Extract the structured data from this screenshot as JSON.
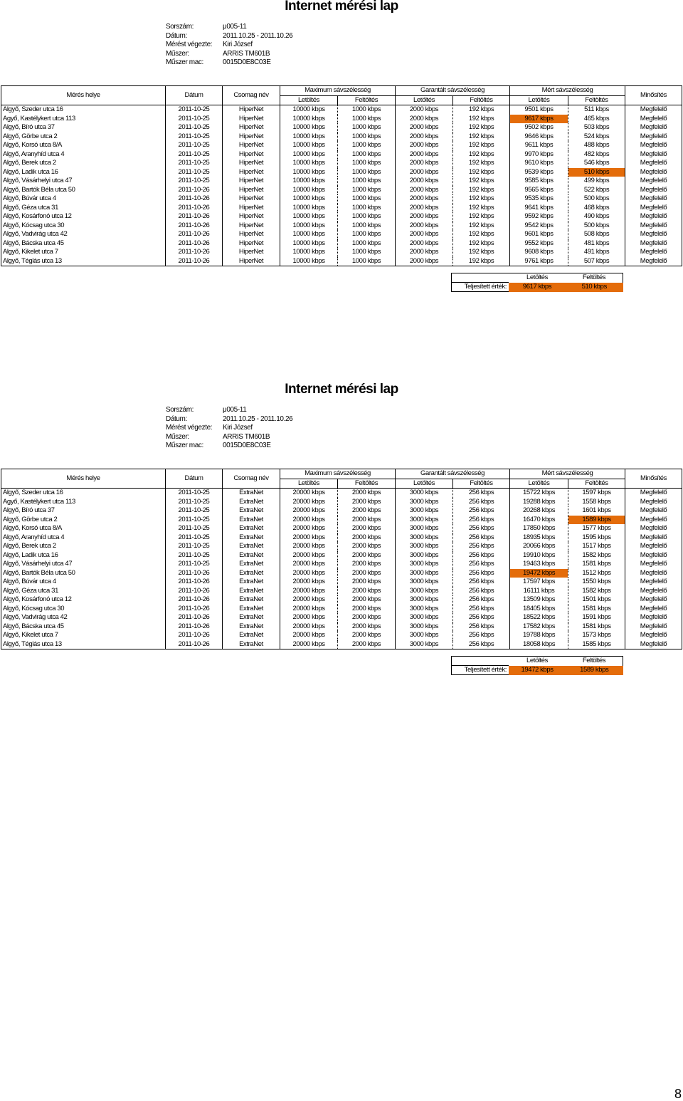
{
  "page_number": "8",
  "highlight_color": "#e46c0a",
  "sheets": [
    {
      "title": "Internet mérési lap",
      "meta": [
        {
          "k": "Sorszám:",
          "v": "μ005-11"
        },
        {
          "k": "Dátum:",
          "v": "2011.10.25 - 2011.10.26"
        },
        {
          "k": "Mérést végezte:",
          "v": "Kiri József"
        },
        {
          "k": "Műszer:",
          "v": "ARRIS TM601B"
        },
        {
          "k": "Műszer mac:",
          "v": "0015D0E8C03E"
        }
      ],
      "headers": {
        "place": "Mérés helye",
        "date": "Dátum",
        "package": "Csomag név",
        "max": "Maximum sávszélesség",
        "guaranteed": "Garantált sávszélesség",
        "measured": "Mért sávszélesség",
        "rating": "Minősítés",
        "down": "Letöltés",
        "up": "Feltöltés"
      },
      "rows": [
        [
          "Algyő, Szeder utca 16",
          "2011-10-25",
          "HiperNet",
          "10000 kbps",
          "1000 kbps",
          "2000 kbps",
          "192 kbps",
          "9501 kbps",
          "511 kbps",
          "Megfelelő"
        ],
        [
          "Agyő, Kastélykert utca 113",
          "2011-10-25",
          "HiperNet",
          "10000 kbps",
          "1000 kbps",
          "2000 kbps",
          "192 kbps",
          "9617 kbps",
          "465 kbps",
          "Megfelelő"
        ],
        [
          "Algyő, Bíró utca 37",
          "2011-10-25",
          "HiperNet",
          "10000 kbps",
          "1000 kbps",
          "2000 kbps",
          "192 kbps",
          "9502 kbps",
          "503 kbps",
          "Megfelelő"
        ],
        [
          "Algyő, Görbe utca 2",
          "2011-10-25",
          "HiperNet",
          "10000 kbps",
          "1000 kbps",
          "2000 kbps",
          "192 kbps",
          "9646 kbps",
          "524 kbps",
          "Megfelelő"
        ],
        [
          "Algyő, Korsó utca 8/A",
          "2011-10-25",
          "HiperNet",
          "10000 kbps",
          "1000 kbps",
          "2000 kbps",
          "192 kbps",
          "9611 kbps",
          "488 kbps",
          "Megfelelő"
        ],
        [
          "Algyő, Aranyhíd utca 4",
          "2011-10-25",
          "HiperNet",
          "10000 kbps",
          "1000 kbps",
          "2000 kbps",
          "192 kbps",
          "9970 kbps",
          "482 kbps",
          "Megfelelő"
        ],
        [
          "Algyő, Berek utca 2",
          "2011-10-25",
          "HiperNet",
          "10000 kbps",
          "1000 kbps",
          "2000 kbps",
          "192 kbps",
          "9610 kbps",
          "546 kbps",
          "Megfelelő"
        ],
        [
          "Algyő, Ladik utca 16",
          "2011-10-25",
          "HiperNet",
          "10000 kbps",
          "1000 kbps",
          "2000 kbps",
          "192 kbps",
          "9539 kbps",
          "510 kbps",
          "Megfelelő"
        ],
        [
          "Algyő, Vásárhelyi utca 47",
          "2011-10-25",
          "HiperNet",
          "10000 kbps",
          "1000 kbps",
          "2000 kbps",
          "192 kbps",
          "9585 kbps",
          "499 kbps",
          "Megfelelő"
        ],
        [
          "Algyő, Bartók Béla utca 50",
          "2011-10-26",
          "HiperNet",
          "10000 kbps",
          "1000 kbps",
          "2000 kbps",
          "192 kbps",
          "9565 kbps",
          "522 kbps",
          "Megfelelő"
        ],
        [
          "Algyő, Búvár utca 4",
          "2011-10-26",
          "HiperNet",
          "10000 kbps",
          "1000 kbps",
          "2000 kbps",
          "192 kbps",
          "9535 kbps",
          "500 kbps",
          "Megfelelő"
        ],
        [
          "Algyő, Géza utca 31",
          "2011-10-26",
          "HiperNet",
          "10000 kbps",
          "1000 kbps",
          "2000 kbps",
          "192 kbps",
          "9641 kbps",
          "468 kbps",
          "Megfelelő"
        ],
        [
          "Algyő, Kosárfonó utca 12",
          "2011-10-26",
          "HiperNet",
          "10000 kbps",
          "1000 kbps",
          "2000 kbps",
          "192 kbps",
          "9592 kbps",
          "490 kbps",
          "Megfelelő"
        ],
        [
          "Algyő, Kócsag utca 30",
          "2011-10-26",
          "HiperNet",
          "10000 kbps",
          "1000 kbps",
          "2000 kbps",
          "192 kbps",
          "9542 kbps",
          "500 kbps",
          "Megfelelő"
        ],
        [
          "Algyő, Vadvirág utca 42",
          "2011-10-26",
          "HiperNet",
          "10000 kbps",
          "1000 kbps",
          "2000 kbps",
          "192 kbps",
          "9601 kbps",
          "508 kbps",
          "Megfelelő"
        ],
        [
          "Algyő, Bácska utca 45",
          "2011-10-26",
          "HiperNet",
          "10000 kbps",
          "1000 kbps",
          "2000 kbps",
          "192 kbps",
          "9552 kbps",
          "481 kbps",
          "Megfelelő"
        ],
        [
          "Algyő, Kikelet utca 7",
          "2011-10-26",
          "HiperNet",
          "10000 kbps",
          "1000 kbps",
          "2000 kbps",
          "192 kbps",
          "9608 kbps",
          "491 kbps",
          "Megfelelő"
        ],
        [
          "Algyő, Téglás utca 13",
          "2011-10-26",
          "HiperNet",
          "10000 kbps",
          "1000 kbps",
          "2000 kbps",
          "192 kbps",
          "9761 kbps",
          "507 kbps",
          "Megfelelő"
        ]
      ],
      "highlight": {
        "down_row": 1,
        "up_row": 7
      },
      "summary": {
        "label": "Teljesített érték:",
        "down": "9617 kbps",
        "up": "510 kbps"
      }
    },
    {
      "title": "Internet mérési lap",
      "meta": [
        {
          "k": "Sorszám:",
          "v": "μ005-11"
        },
        {
          "k": "Dátum:",
          "v": "2011.10.25 - 2011.10.26"
        },
        {
          "k": "Mérést végezte:",
          "v": "Kiri József"
        },
        {
          "k": "Műszer:",
          "v": "ARRIS TM601B"
        },
        {
          "k": "Műszer mac:",
          "v": "0015D0E8C03E"
        }
      ],
      "headers": {
        "place": "Mérés helye",
        "date": "Dátum",
        "package": "Csomag név",
        "max": "Maximum sávszélesség",
        "guaranteed": "Garantált sávszélesség",
        "measured": "Mért sávszélesség",
        "rating": "Minősítés",
        "down": "Letöltés",
        "up": "Feltöltés"
      },
      "rows": [
        [
          "Algyő, Szeder utca 16",
          "2011-10-25",
          "ExtraNet",
          "20000 kbps",
          "2000 kbps",
          "3000 kbps",
          "256 kbps",
          "15722 kbps",
          "1597 kbps",
          "Megfelelő"
        ],
        [
          "Agyő, Kastélykert utca 113",
          "2011-10-25",
          "ExtraNet",
          "20000 kbps",
          "2000 kbps",
          "3000 kbps",
          "256 kbps",
          "19288 kbps",
          "1558 kbps",
          "Megfelelő"
        ],
        [
          "Algyő, Bíró utca 37",
          "2011-10-25",
          "ExtraNet",
          "20000 kbps",
          "2000 kbps",
          "3000 kbps",
          "256 kbps",
          "20268 kbps",
          "1601 kbps",
          "Megfelelő"
        ],
        [
          "Algyő, Görbe utca 2",
          "2011-10-25",
          "ExtraNet",
          "20000 kbps",
          "2000 kbps",
          "3000 kbps",
          "256 kbps",
          "16470 kbps",
          "1589 kbps",
          "Megfelelő"
        ],
        [
          "Algyő, Korsó utca 8/A",
          "2011-10-25",
          "ExtraNet",
          "20000 kbps",
          "2000 kbps",
          "3000 kbps",
          "256 kbps",
          "17850 kbps",
          "1577 kbps",
          "Megfelelő"
        ],
        [
          "Algyő, Aranyhíd utca 4",
          "2011-10-25",
          "ExtraNet",
          "20000 kbps",
          "2000 kbps",
          "3000 kbps",
          "256 kbps",
          "18935 kbps",
          "1595 kbps",
          "Megfelelő"
        ],
        [
          "Algyő, Berek utca 2",
          "2011-10-25",
          "ExtraNet",
          "20000 kbps",
          "2000 kbps",
          "3000 kbps",
          "256 kbps",
          "20066 kbps",
          "1517 kbps",
          "Megfelelő"
        ],
        [
          "Algyő, Ladik utca 16",
          "2011-10-25",
          "ExtraNet",
          "20000 kbps",
          "2000 kbps",
          "3000 kbps",
          "256 kbps",
          "19910 kbps",
          "1582 kbps",
          "Megfelelő"
        ],
        [
          "Algyő, Vásárhelyi utca 47",
          "2011-10-25",
          "ExtraNet",
          "20000 kbps",
          "2000 kbps",
          "3000 kbps",
          "256 kbps",
          "19463 kbps",
          "1581 kbps",
          "Megfelelő"
        ],
        [
          "Algyő, Bartók Béla utca 50",
          "2011-10-26",
          "ExtraNet",
          "20000 kbps",
          "2000 kbps",
          "3000 kbps",
          "256 kbps",
          "19472 kbps",
          "1512 kbps",
          "Megfelelő"
        ],
        [
          "Algyő, Búvár utca 4",
          "2011-10-26",
          "ExtraNet",
          "20000 kbps",
          "2000 kbps",
          "3000 kbps",
          "256 kbps",
          "17597 kbps",
          "1550 kbps",
          "Megfelelő"
        ],
        [
          "Algyő, Géza utca 31",
          "2011-10-26",
          "ExtraNet",
          "20000 kbps",
          "2000 kbps",
          "3000 kbps",
          "256 kbps",
          "16111 kbps",
          "1582 kbps",
          "Megfelelő"
        ],
        [
          "Algyő, Kosárfonó utca 12",
          "2011-10-26",
          "ExtraNet",
          "20000 kbps",
          "2000 kbps",
          "3000 kbps",
          "256 kbps",
          "13509 kbps",
          "1501 kbps",
          "Megfelelő"
        ],
        [
          "Algyő, Kócsag utca 30",
          "2011-10-26",
          "ExtraNet",
          "20000 kbps",
          "2000 kbps",
          "3000 kbps",
          "256 kbps",
          "18405 kbps",
          "1581 kbps",
          "Megfelelő"
        ],
        [
          "Algyő, Vadvirág utca 42",
          "2011-10-26",
          "ExtraNet",
          "20000 kbps",
          "2000 kbps",
          "3000 kbps",
          "256 kbps",
          "18522 kbps",
          "1591 kbps",
          "Megfelelő"
        ],
        [
          "Algyő, Bácska utca 45",
          "2011-10-26",
          "ExtraNet",
          "20000 kbps",
          "2000 kbps",
          "3000 kbps",
          "256 kbps",
          "17582 kbps",
          "1581 kbps",
          "Megfelelő"
        ],
        [
          "Algyő, Kikelet utca 7",
          "2011-10-26",
          "ExtraNet",
          "20000 kbps",
          "2000 kbps",
          "3000 kbps",
          "256 kbps",
          "19788 kbps",
          "1573 kbps",
          "Megfelelő"
        ],
        [
          "Algyő, Téglás utca 13",
          "2011-10-26",
          "ExtraNet",
          "20000 kbps",
          "2000 kbps",
          "3000 kbps",
          "256 kbps",
          "18058 kbps",
          "1585 kbps",
          "Megfelelő"
        ]
      ],
      "highlight": {
        "down_row": 9,
        "up_row": 3
      },
      "summary": {
        "label": "Teljesített érték:",
        "down": "19472 kbps",
        "up": "1589 kbps"
      }
    }
  ]
}
